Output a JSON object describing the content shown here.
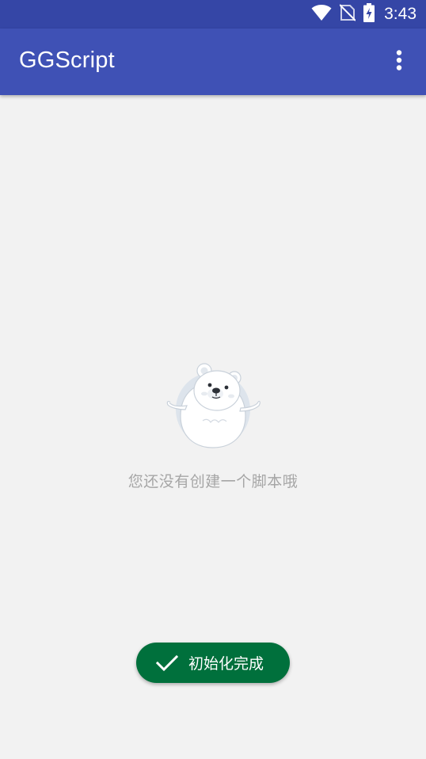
{
  "status_bar": {
    "time": "3:43",
    "icons": [
      "wifi-icon",
      "no-sim-icon",
      "battery-charging-icon"
    ]
  },
  "app_bar": {
    "title": "GGScript",
    "overflow_icon": "more-vert-icon",
    "background_color": "#3f51b5",
    "status_bar_color": "#3546a6"
  },
  "empty_state": {
    "illustration": "polar-bear-shrug",
    "message": "您还没有创建一个脚本哦"
  },
  "toast": {
    "icon": "check-icon",
    "message": "初始化完成",
    "background_color": "#00703c"
  }
}
